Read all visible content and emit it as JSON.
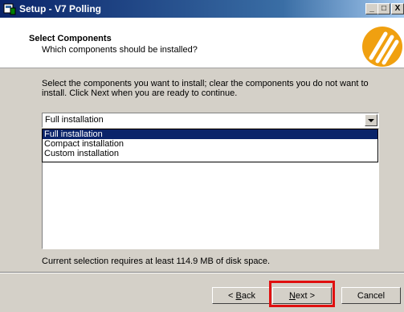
{
  "window": {
    "title": "Setup - V7 Polling",
    "minimize_label": "_",
    "maximize_label": "□",
    "close_label": "X"
  },
  "header": {
    "title": "Select Components",
    "subtitle": "Which components should be installed?"
  },
  "body": {
    "instructions": "Select the components you want to install; clear the components you do not want to install. Click Next when you are ready to continue.",
    "combo_value": "Full installation",
    "options": [
      "Full installation",
      "Compact installation",
      "Custom installation"
    ],
    "selected_index": 0,
    "disk_space": "Current selection requires at least 114.9 MB of disk space."
  },
  "buttons": {
    "back": {
      "prefix": "< ",
      "mnemonic": "B",
      "rest": "ack"
    },
    "next": {
      "mnemonic": "N",
      "rest": "ext >"
    },
    "cancel": "Cancel"
  },
  "colors": {
    "titlebar": "#0a246a",
    "selection": "#0a246a",
    "highlight_box": "#e01010",
    "logo": "#f0a010"
  }
}
